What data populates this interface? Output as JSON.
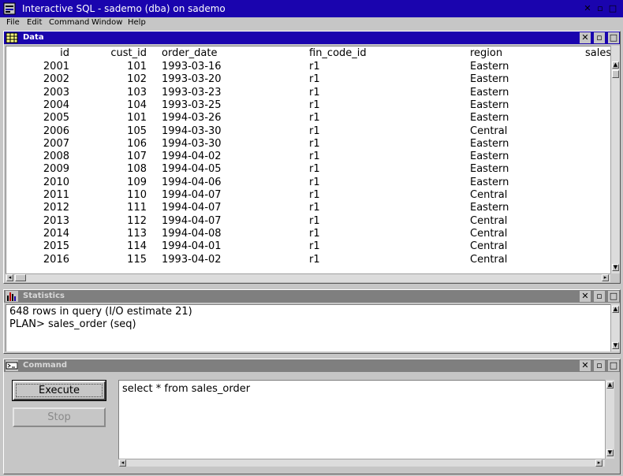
{
  "app": {
    "title": "Interactive SQL - sademo (dba) on sademo",
    "window_controls": [
      "✕",
      "▫",
      "□"
    ]
  },
  "menu": {
    "items": [
      {
        "label": "File",
        "mnemonic": "F"
      },
      {
        "label": "Edit",
        "mnemonic": "E"
      },
      {
        "label": "Command",
        "mnemonic": "C"
      },
      {
        "label": "Window",
        "mnemonic": "W"
      },
      {
        "label": "Help",
        "mnemonic": "H"
      }
    ]
  },
  "data_window": {
    "title": "Data",
    "columns": [
      "id",
      "cust_id",
      "order_date",
      "fin_code_id",
      "region",
      "sales"
    ],
    "rows": [
      [
        "2001",
        "101",
        "1993-03-16",
        "r1",
        "Eastern"
      ],
      [
        "2002",
        "102",
        "1993-03-20",
        "r1",
        "Eastern"
      ],
      [
        "2003",
        "103",
        "1993-03-23",
        "r1",
        "Eastern"
      ],
      [
        "2004",
        "104",
        "1993-03-25",
        "r1",
        "Eastern"
      ],
      [
        "2005",
        "101",
        "1994-03-26",
        "r1",
        "Eastern"
      ],
      [
        "2006",
        "105",
        "1994-03-30",
        "r1",
        "Central"
      ],
      [
        "2007",
        "106",
        "1994-03-30",
        "r1",
        "Eastern"
      ],
      [
        "2008",
        "107",
        "1994-04-02",
        "r1",
        "Eastern"
      ],
      [
        "2009",
        "108",
        "1994-04-05",
        "r1",
        "Eastern"
      ],
      [
        "2010",
        "109",
        "1994-04-06",
        "r1",
        "Eastern"
      ],
      [
        "2011",
        "110",
        "1994-04-07",
        "r1",
        "Central"
      ],
      [
        "2012",
        "111",
        "1994-04-07",
        "r1",
        "Eastern"
      ],
      [
        "2013",
        "112",
        "1994-04-07",
        "r1",
        "Central"
      ],
      [
        "2014",
        "113",
        "1994-04-08",
        "r1",
        "Central"
      ],
      [
        "2015",
        "114",
        "1994-04-01",
        "r1",
        "Central"
      ],
      [
        "2016",
        "115",
        "1993-04-02",
        "r1",
        "Central"
      ]
    ]
  },
  "statistics_window": {
    "title": "Statistics",
    "lines": [
      "648 rows in query (I/O estimate 21)",
      "PLAN> sales_order (seq)"
    ]
  },
  "command_window": {
    "title": "Command",
    "execute_label": "Execute",
    "stop_label": "Stop",
    "sql_text": "select * from sales_order"
  },
  "colors": {
    "active_title": "#1a04ae",
    "inactive_title": "#7f7f7f",
    "face": "#c6c6c6"
  }
}
